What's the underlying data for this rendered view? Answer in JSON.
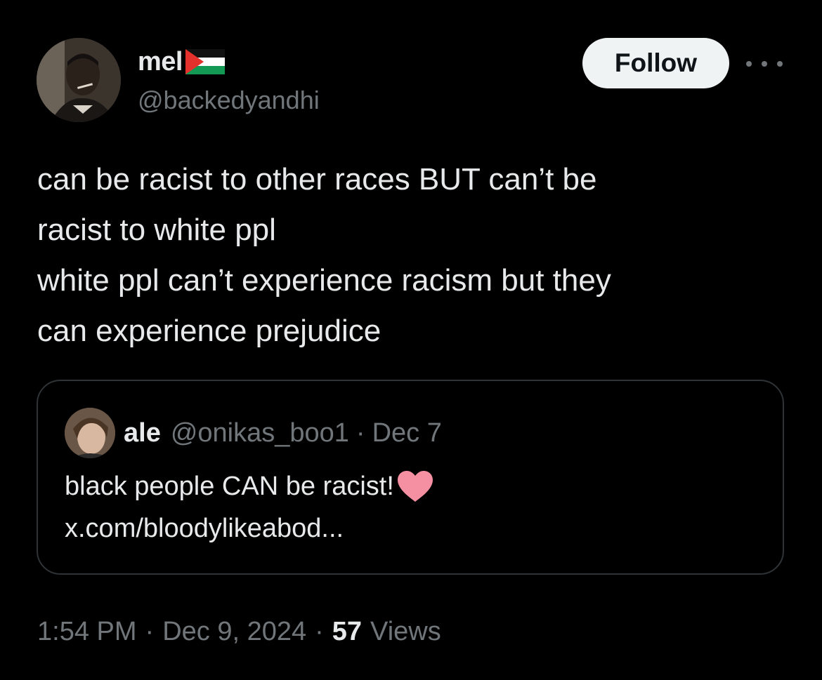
{
  "author": {
    "display_name": "mel",
    "flag_icon": "palestine-flag-icon",
    "handle": "@backedyandhi"
  },
  "actions": {
    "follow_label": "Follow",
    "more_icon": "more-horizontal-icon"
  },
  "tweet": {
    "lines": [
      "can be racist to other races BUT can’t be",
      "racist to white ppl",
      "white ppl can’t experience racism but they",
      "can experience prejudice"
    ]
  },
  "quote": {
    "name": "ale",
    "handle": "@onikas_boo1",
    "separator": "·",
    "date": "Dec 7",
    "text_line1": "black people CAN be racist!",
    "heart_icon": "pink-heart-icon",
    "text_line2": "x.com/bloodylikeabod..."
  },
  "meta": {
    "time": "1:54 PM",
    "separator": "·",
    "date": "Dec 9, 2024",
    "views_count": "57",
    "views_label": "Views"
  },
  "colors": {
    "background": "#000000",
    "text_primary": "#e7e9ea",
    "text_secondary": "#71767b",
    "border": "#2f3336",
    "follow_bg": "#eff3f4",
    "heart": "#f58fa2"
  }
}
